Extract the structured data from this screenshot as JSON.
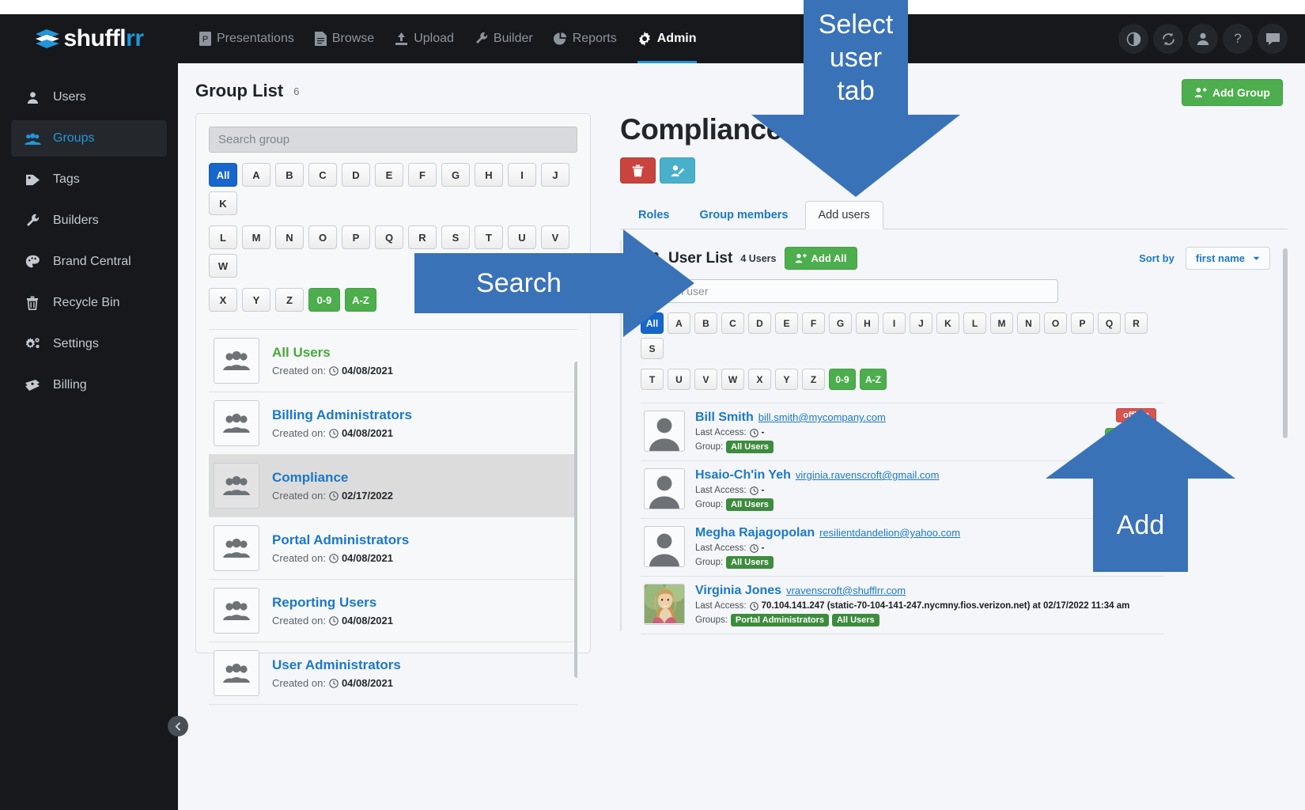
{
  "brand": {
    "name_dark": "shuffl",
    "name_accent": "rr"
  },
  "topnav": {
    "items": [
      {
        "label": "Presentations",
        "icon": "presentation-file-icon",
        "active": false
      },
      {
        "label": "Browse",
        "icon": "document-icon",
        "active": false
      },
      {
        "label": "Upload",
        "icon": "upload-icon",
        "active": false
      },
      {
        "label": "Builder",
        "icon": "wrench-icon",
        "active": false
      },
      {
        "label": "Reports",
        "icon": "pie-chart-icon",
        "active": false
      },
      {
        "label": "Admin",
        "icon": "gear-icon",
        "active": true
      }
    ],
    "right_icons": [
      "contrast-icon",
      "refresh-icon",
      "user-icon",
      "help-icon",
      "chat-icon"
    ]
  },
  "sidebar": {
    "items": [
      {
        "label": "Users",
        "icon": "user-icon",
        "active": false
      },
      {
        "label": "Groups",
        "icon": "users-group-icon",
        "active": true
      },
      {
        "label": "Tags",
        "icon": "tag-icon",
        "active": false
      },
      {
        "label": "Builders",
        "icon": "wrench-icon",
        "active": false
      },
      {
        "label": "Brand Central",
        "icon": "palette-icon",
        "active": false
      },
      {
        "label": "Recycle Bin",
        "icon": "trash-icon",
        "active": false
      },
      {
        "label": "Settings",
        "icon": "gears-icon",
        "active": false
      },
      {
        "label": "Billing",
        "icon": "money-icon",
        "active": false
      }
    ],
    "collapse_icon": "chevron-left-icon"
  },
  "page": {
    "title": "Group List",
    "count": "6",
    "add_group_label": "Add Group"
  },
  "group_panel": {
    "search_placeholder": "Search group",
    "alpha_row1": [
      "All",
      "A",
      "B",
      "C",
      "D",
      "E",
      "F",
      "G",
      "H",
      "I",
      "J",
      "K"
    ],
    "alpha_row2": [
      "L",
      "M",
      "N",
      "O",
      "P",
      "Q",
      "R",
      "S",
      "T",
      "U",
      "V",
      "W"
    ],
    "alpha_row3": [
      "X",
      "Y",
      "Z",
      "0-9",
      "A-Z"
    ],
    "created_label": "Created on:",
    "groups": [
      {
        "name": "All Users",
        "created": "04/08/2021",
        "selected": false,
        "style": "green"
      },
      {
        "name": "Billing Administrators",
        "created": "04/08/2021",
        "selected": false,
        "style": "blue"
      },
      {
        "name": "Compliance",
        "created": "02/17/2022",
        "selected": true,
        "style": "blue"
      },
      {
        "name": "Portal Administrators",
        "created": "04/08/2021",
        "selected": false,
        "style": "blue"
      },
      {
        "name": "Reporting Users",
        "created": "04/08/2021",
        "selected": false,
        "style": "blue"
      },
      {
        "name": "User Administrators",
        "created": "04/08/2021",
        "selected": false,
        "style": "blue"
      }
    ]
  },
  "detail": {
    "group_name": "Compliance",
    "delete_icon": "trash-icon",
    "edit_icon": "user-edit-icon",
    "tabs": [
      {
        "label": "Roles",
        "active": false
      },
      {
        "label": "Group members",
        "active": false
      },
      {
        "label": "Add users",
        "active": true
      }
    ]
  },
  "user_list": {
    "icon": "users-group-icon",
    "title": "User List",
    "count": "4 Users",
    "add_all_label": "Add All",
    "sort_by_label": "Sort by",
    "sort_value": "first name",
    "search_placeholder": "Search user",
    "alpha_row1": [
      "All",
      "A",
      "B",
      "C",
      "D",
      "E",
      "F",
      "G",
      "H",
      "I",
      "J",
      "K",
      "L",
      "M",
      "N",
      "O",
      "P",
      "Q",
      "R",
      "S"
    ],
    "alpha_row2": [
      "T",
      "U",
      "V",
      "W",
      "X",
      "Y",
      "Z",
      "0-9",
      "A-Z"
    ],
    "last_access_label": "Last Access:",
    "group_label": "Group:",
    "groups_label": "Groups:",
    "add_label": "Add",
    "status_offline": "offline",
    "users": [
      {
        "name": "Bill Smith",
        "email": "bill.smith@mycompany.com",
        "last_access": "-",
        "group_label": "Group:",
        "groups": [
          "All Users"
        ],
        "status": "offline",
        "has_add": true,
        "avatar": "placeholder"
      },
      {
        "name": "Hsaio-Ch'in Yeh",
        "email": "virginia.ravenscroft@gmail.com",
        "last_access": "-",
        "group_label": "Group:",
        "groups": [
          "All Users"
        ],
        "status": "",
        "has_add": false,
        "avatar": "placeholder"
      },
      {
        "name": "Megha Rajagopolan",
        "email": "resilientdandelion@yahoo.com",
        "last_access": "-",
        "group_label": "Group:",
        "groups": [
          "All Users"
        ],
        "status": "",
        "has_add": false,
        "avatar": "placeholder"
      },
      {
        "name": "Virginia Jones",
        "email": "vravenscroft@shufflrr.com",
        "last_access": "70.104.141.247 (static-70-104-141-247.nycmny.fios.verizon.net) at 02/17/2022 11:34 am",
        "group_label": "Groups:",
        "groups": [
          "Portal Administrators",
          "All Users"
        ],
        "status": "",
        "has_add": false,
        "avatar": "photo"
      }
    ]
  },
  "annotations": {
    "select_user_tab": "Select user tab",
    "search": "Search",
    "add": "Add",
    "color": "#3a72b8"
  }
}
